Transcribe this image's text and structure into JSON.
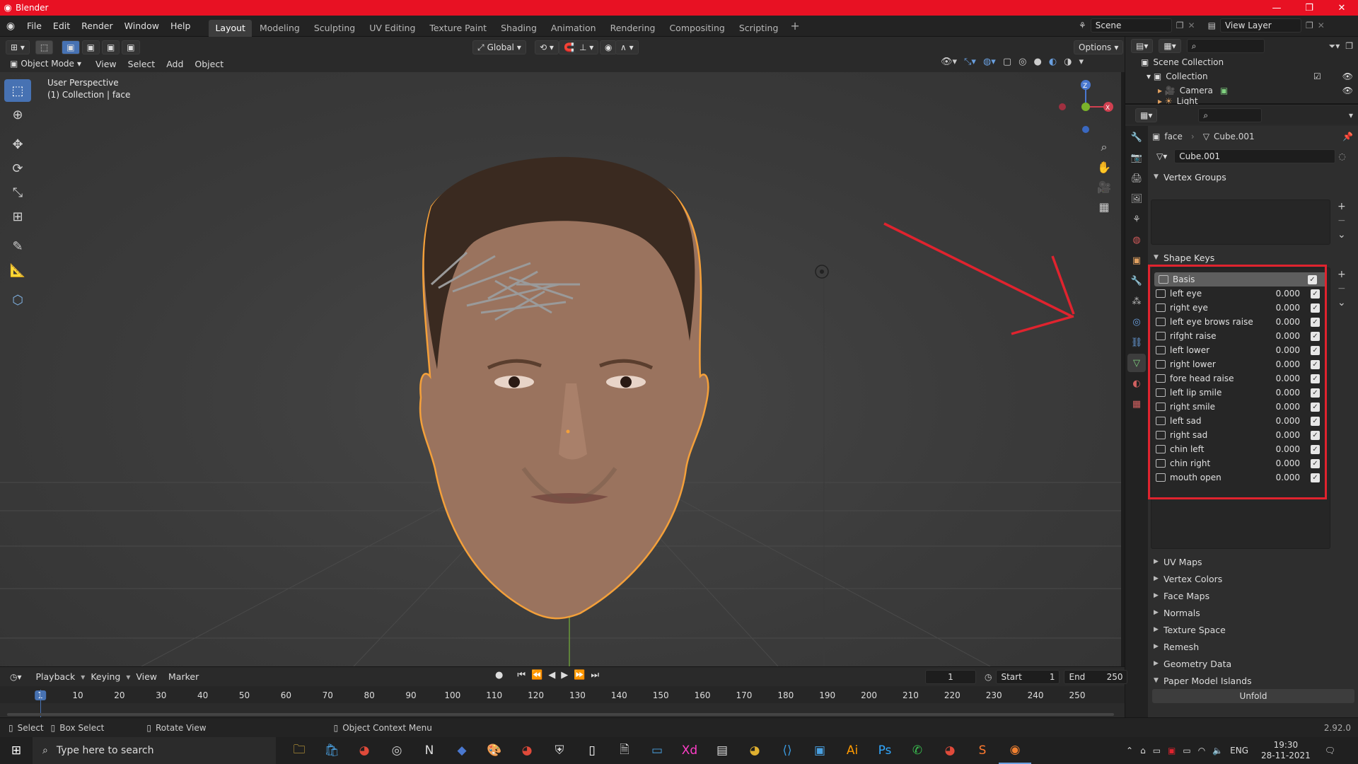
{
  "window": {
    "title": "Blender"
  },
  "menu": [
    "File",
    "Edit",
    "Render",
    "Window",
    "Help"
  ],
  "workspaces": [
    {
      "label": "Layout",
      "active": true
    },
    {
      "label": "Modeling"
    },
    {
      "label": "Sculpting"
    },
    {
      "label": "UV Editing"
    },
    {
      "label": "Texture Paint"
    },
    {
      "label": "Shading"
    },
    {
      "label": "Animation"
    },
    {
      "label": "Rendering"
    },
    {
      "label": "Compositing"
    },
    {
      "label": "Scripting"
    }
  ],
  "scene": {
    "name": "Scene"
  },
  "view_layer": {
    "name": "View Layer"
  },
  "viewport_header": {
    "transform_orientation": "Global",
    "options_label": "Options",
    "mode": "Object Mode",
    "menus": [
      "View",
      "Select",
      "Add",
      "Object"
    ]
  },
  "viewport": {
    "perspective": "User Perspective",
    "collection_info": "(1) Collection | face"
  },
  "outliner": {
    "root": "Scene Collection",
    "collection": "Collection",
    "items": [
      "Camera",
      "Light"
    ]
  },
  "properties": {
    "object": "face",
    "mesh": "Cube.001",
    "mesh_field": "Cube.001",
    "vertex_groups_label": "Vertex Groups",
    "shape_keys_label": "Shape Keys",
    "shape_keys": [
      {
        "name": "Basis",
        "value": "",
        "checked": true,
        "selected": true
      },
      {
        "name": "left eye",
        "value": "0.000"
      },
      {
        "name": "right eye",
        "value": "0.000"
      },
      {
        "name": "left eye brows raise",
        "value": "0.000"
      },
      {
        "name": "rifght raise",
        "value": "0.000"
      },
      {
        "name": "left lower",
        "value": "0.000"
      },
      {
        "name": "right lower",
        "value": "0.000"
      },
      {
        "name": "fore head raise",
        "value": "0.000"
      },
      {
        "name": "left lip smile",
        "value": "0.000"
      },
      {
        "name": "right smile",
        "value": "0.000"
      },
      {
        "name": "left sad",
        "value": "0.000"
      },
      {
        "name": "right sad",
        "value": "0.000"
      },
      {
        "name": "chin left",
        "value": "0.000"
      },
      {
        "name": "chin right",
        "value": "0.000"
      },
      {
        "name": "mouth open",
        "value": "0.000"
      }
    ],
    "collapsed_panels": [
      "UV Maps",
      "Vertex Colors",
      "Face Maps",
      "Normals",
      "Texture Space",
      "Remesh",
      "Geometry Data"
    ],
    "paper_model_label": "Paper Model Islands",
    "unfold_label": "Unfold"
  },
  "timeline": {
    "menus": [
      "Playback",
      "Keying",
      "View",
      "Marker"
    ],
    "current_frame": "1",
    "start_label": "Start",
    "start": "1",
    "end_label": "End",
    "end": "250",
    "ticks": [
      "1",
      "10",
      "20",
      "30",
      "40",
      "50",
      "60",
      "70",
      "80",
      "90",
      "100",
      "110",
      "120",
      "130",
      "140",
      "150",
      "160",
      "170",
      "180",
      "190",
      "200",
      "210",
      "220",
      "230",
      "240",
      "250"
    ]
  },
  "statusbar": {
    "select": "Select",
    "box_select": "Box Select",
    "rotate_view": "Rotate View",
    "context_menu": "Object Context Menu",
    "version": "2.92.0"
  },
  "taskbar": {
    "search_placeholder": "Type here to search",
    "language": "ENG",
    "time": "19:30",
    "date": "28-11-2021"
  },
  "colors": {
    "accent": "#4772b3",
    "highlight_box": "#e0232e",
    "selection_outline": "#f4a03a",
    "titlebar": "#e81123"
  }
}
